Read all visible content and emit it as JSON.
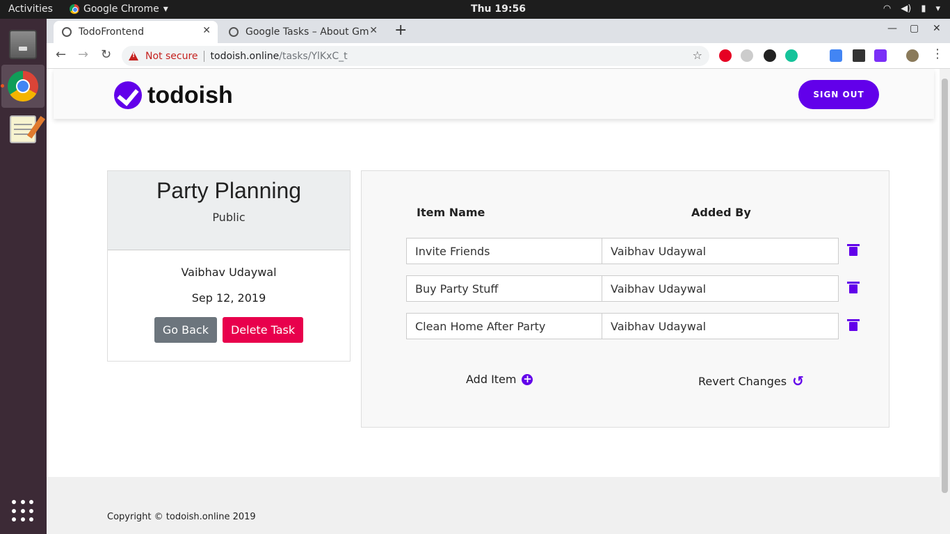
{
  "system": {
    "activities": "Activities",
    "app_name": "Google Chrome",
    "clock": "Thu 19:56"
  },
  "browser": {
    "tabs": [
      {
        "label": "TodoFrontend"
      },
      {
        "label": "Google Tasks – About Gm"
      }
    ],
    "new_tab_symbol": "+",
    "security_label": "Not secure",
    "url_host": "todoish.online",
    "url_path": "/tasks/YlKxC_t"
  },
  "site": {
    "logo_text": "todoish",
    "sign_out": "SIGN OUT",
    "accent": "#6200ea"
  },
  "task": {
    "title": "Party Planning",
    "visibility": "Public",
    "owner": "Vaibhav Udaywal",
    "date": "Sep 12, 2019",
    "go_back": "Go Back",
    "delete": "Delete Task"
  },
  "items": {
    "col_name": "Item Name",
    "col_added_by": "Added By",
    "rows": [
      {
        "name": "Invite Friends",
        "added_by": "Vaibhav Udaywal"
      },
      {
        "name": "Buy Party Stuff",
        "added_by": "Vaibhav Udaywal"
      },
      {
        "name": "Clean Home After Party",
        "added_by": "Vaibhav Udaywal"
      }
    ],
    "add_item": "Add Item",
    "revert": "Revert Changes"
  },
  "footer": {
    "copyright": "Copyright © todoish.online 2019"
  }
}
